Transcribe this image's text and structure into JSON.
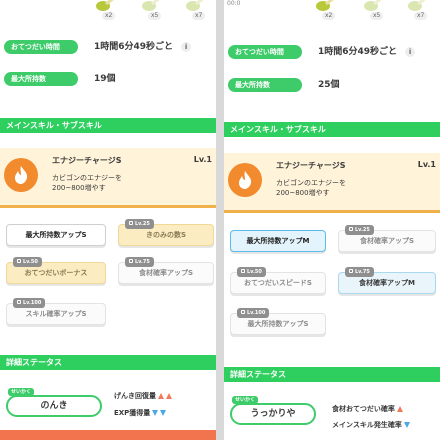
{
  "left": {
    "ingredients": [
      {
        "icon": "leek-icon",
        "qty": "x2"
      },
      {
        "icon": "leek-icon",
        "qty": "x5"
      },
      {
        "icon": "leek-icon",
        "qty": "x7"
      }
    ],
    "help_time_label": "おてつだい時間",
    "help_time_value": "1時間6分49秒ごと",
    "max_carry_label": "最大所持数",
    "max_carry_value": "19個",
    "skills_header": "メインスキル・サブスキル",
    "main_skill": {
      "name": "エナジーチャージS",
      "level": "Lv.1",
      "description": "カビゴンのエナジーを\n200~800増やす"
    },
    "subskills": [
      {
        "label": "最大所持数アップS",
        "tag": ""
      },
      {
        "label": "きのみの数S",
        "tag": "Lv.25"
      },
      {
        "label": "おてつだいボーナス",
        "tag": "Lv.50"
      },
      {
        "label": "食材確率アップS",
        "tag": "Lv.75"
      },
      {
        "label": "スキル確率アップS",
        "tag": "Lv.100"
      }
    ],
    "stats_header": "詳細ステータス",
    "nature_tag": "せいかく",
    "nature": "のんき",
    "nature_up": "げんき回復量",
    "nature_down": "EXP獲得量"
  },
  "right": {
    "top_label": "00:0",
    "ingredients": [
      {
        "icon": "leek-icon",
        "qty": "x2"
      },
      {
        "icon": "leek-icon",
        "qty": "x5"
      },
      {
        "icon": "leek-icon",
        "qty": "x7"
      }
    ],
    "help_time_label": "おてつだい時間",
    "help_time_value": "1時間6分49秒ごと",
    "max_carry_label": "最大所持数",
    "max_carry_value": "25個",
    "skills_header": "メインスキル・サブスキル",
    "main_skill": {
      "name": "エナジーチャージS",
      "level": "Lv.1",
      "description": "カビゴンのエナジーを\n200~800増やす"
    },
    "subskills": [
      {
        "label": "最大所持数アップM",
        "tag": ""
      },
      {
        "label": "食材確率アップS",
        "tag": "Lv.25"
      },
      {
        "label": "おてつだいスピードS",
        "tag": "Lv.50"
      },
      {
        "label": "食材確率アップM",
        "tag": "Lv.75"
      },
      {
        "label": "最大所持数アップS",
        "tag": "Lv.100"
      }
    ],
    "stats_header": "詳細ステータス",
    "nature_tag": "せいかく",
    "nature": "うっかりや",
    "nature_up": "食材おてつだい確率",
    "nature_down": "メインスキル発生確率"
  },
  "colors": {
    "accent_green": "#2fcf5f",
    "skill_orange": "#f28a2e",
    "selected_blue": "#5cbbe8",
    "up_red": "#f07a5a",
    "down_blue": "#4aa8e8"
  }
}
